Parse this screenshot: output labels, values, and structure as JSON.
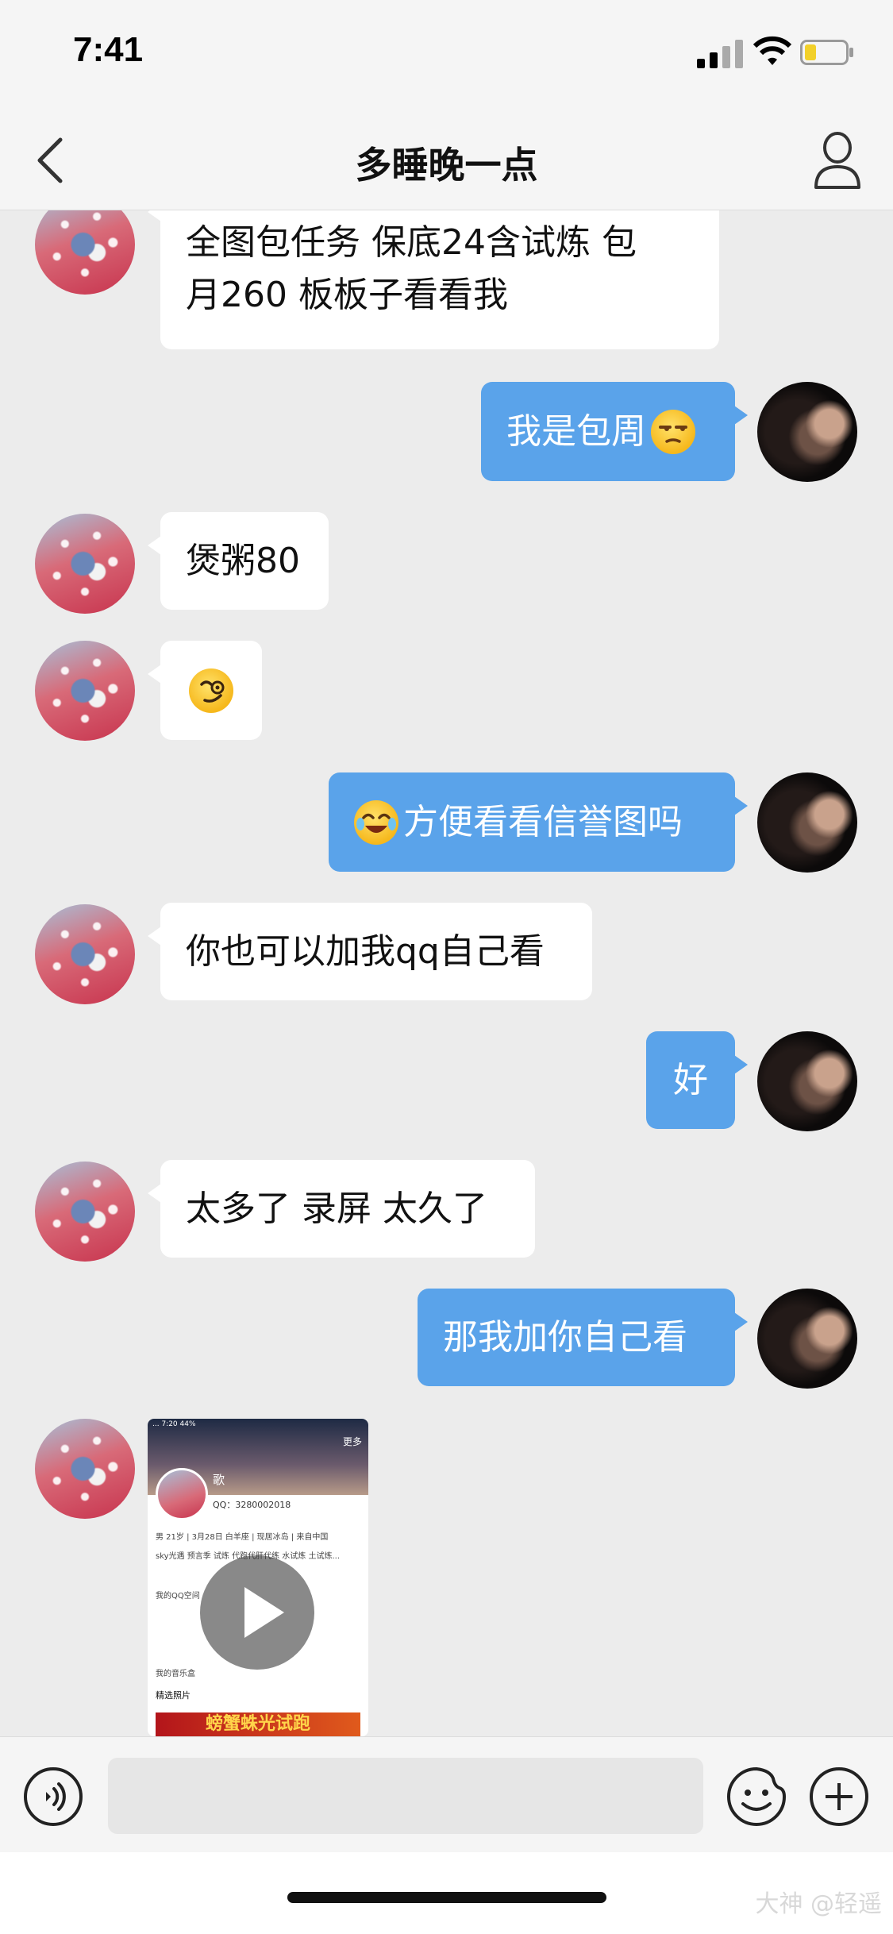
{
  "status_bar": {
    "time": "7:41"
  },
  "header": {
    "title": "多睡晚一点"
  },
  "messages": [
    {
      "sender": "other",
      "text": "全图包任务 保底24含试炼 包\n月260 板板子看看我"
    },
    {
      "sender": "self",
      "text": "我是包周",
      "emoji": "unamused-face"
    },
    {
      "sender": "other",
      "text": "煲粥80"
    },
    {
      "sender": "other",
      "text": "",
      "emoji": "smirk-face"
    },
    {
      "sender": "self",
      "text": "方便看看信誉图吗",
      "emoji": "tears-of-joy-face"
    },
    {
      "sender": "other",
      "text": "你也可以加我qq自己看"
    },
    {
      "sender": "self",
      "text": "好"
    },
    {
      "sender": "other",
      "text": "太多了 录屏 太久了"
    },
    {
      "sender": "self",
      "text": "那我加你自己看"
    }
  ],
  "video": {
    "status": "...  7:20  44%",
    "more": "更多",
    "name": "歌",
    "qq": "QQ：3280002018",
    "lines": [
      "男 21岁 | 3月28日 白羊座 | 现居冰岛 | 来自中国",
      "sky光遇 预言季 试炼 代跑代肝代练 水试炼 土试炼...",
      "我的QQ空间",
      "我的音乐盒",
      "精选照片"
    ],
    "banner": "螃蟹蛛光试跑"
  },
  "input": {
    "placeholder": ""
  },
  "watermark": "大神 @轻遥",
  "colors": {
    "self_bubble": "#5aa3ea",
    "other_bubble": "#ffffff",
    "background": "#ececec"
  }
}
